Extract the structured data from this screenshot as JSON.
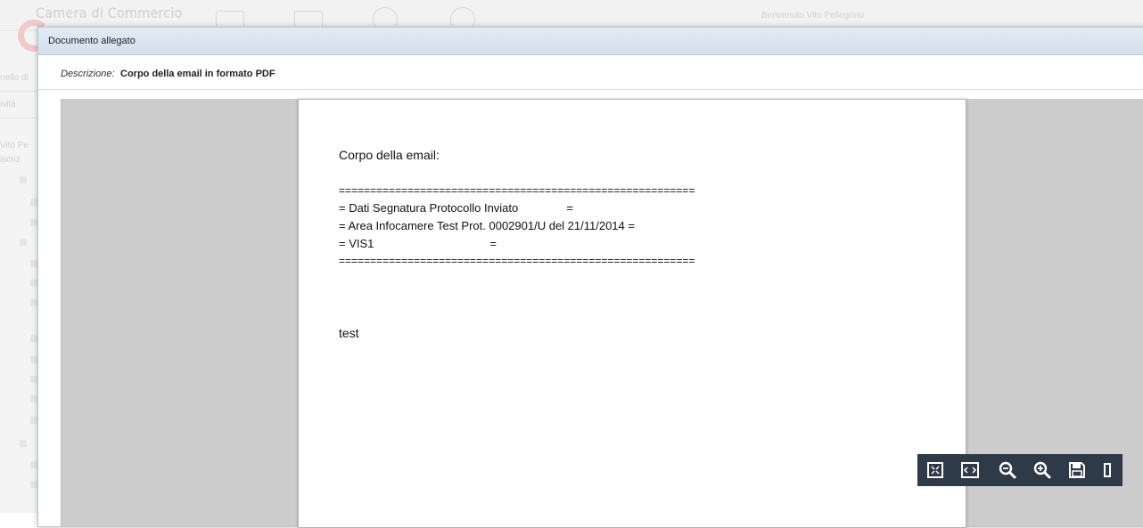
{
  "background": {
    "brand": "Camera di Commercio",
    "welcome": "Benvenuto Vito Pellegrino",
    "sidebar": {
      "item1": "nello di",
      "item2": "ività",
      "item3": "Vito Pe",
      "item4": "iscriz."
    }
  },
  "modal": {
    "title": "Documento allegato",
    "description_label": "Descrizione:",
    "description_value": "Corpo della email in formato PDF"
  },
  "document": {
    "lines": [
      "Corpo della email:",
      "=========================================================",
      "= Dati Segnatura Protocollo Inviato               =",
      "= Area Infocamere Test Prot. 0002901/U del 21/11/2014 =",
      "= VIS1                                    =",
      "=========================================================",
      "test"
    ]
  },
  "toolbar": {
    "buttons": [
      {
        "icon": "fit-page-icon"
      },
      {
        "icon": "fit-width-icon"
      },
      {
        "icon": "zoom-out-icon"
      },
      {
        "icon": "zoom-in-icon"
      },
      {
        "icon": "save-icon"
      }
    ],
    "color": "#2f3a48"
  }
}
